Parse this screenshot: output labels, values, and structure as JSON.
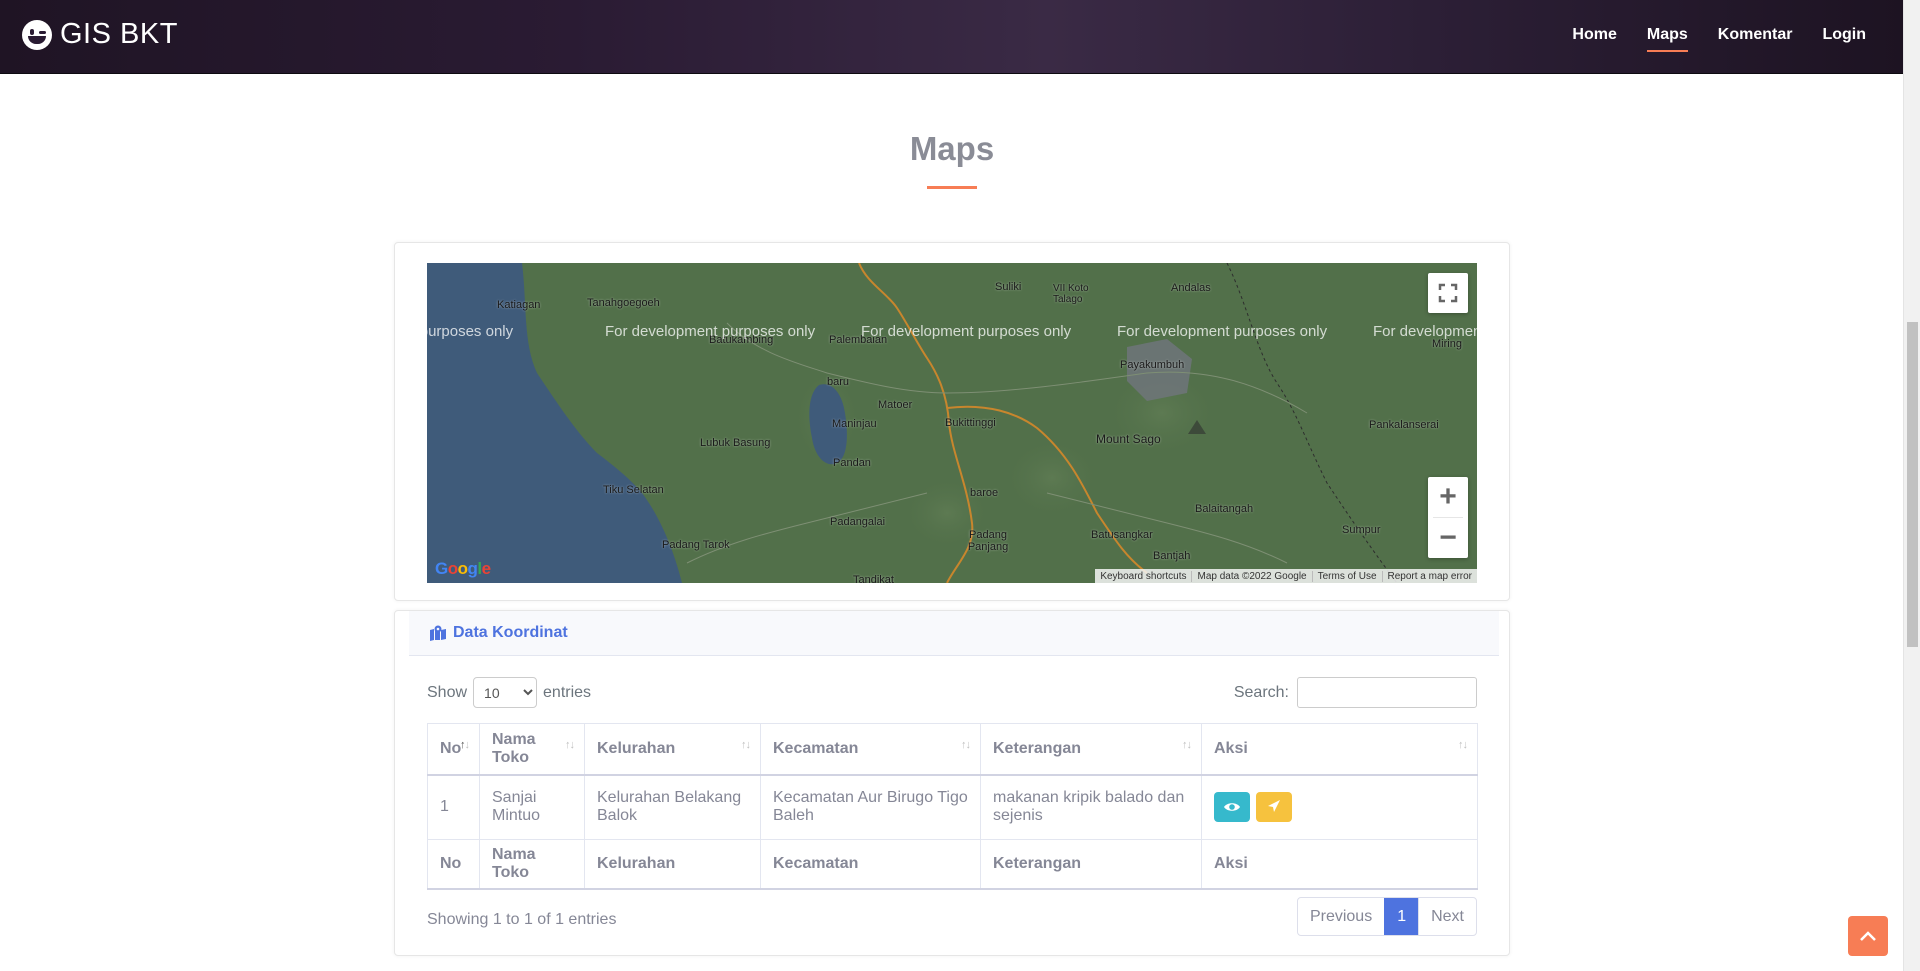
{
  "header": {
    "brand": "GIS BKT",
    "nav": [
      {
        "label": "Home"
      },
      {
        "label": "Maps"
      },
      {
        "label": "Komentar"
      },
      {
        "label": "Login"
      }
    ]
  },
  "section": {
    "title": "Maps"
  },
  "map": {
    "watermark": "For development purposes only",
    "labels": [
      "Katiagan",
      "Tanahgoegoeh",
      "Batukambing",
      "Palembaian",
      "Suliki",
      "VII Koto Talago",
      "Andalas",
      "Miring",
      "Payakumbuh",
      "baru",
      "Matoer",
      "Maninjau",
      "Bukittinggi",
      "Mount Sago",
      "Pankalanserai",
      "Lubuk Basung",
      "Pandan",
      "Tiku Selatan",
      "baroe",
      "Balaitangah",
      "Padangalai",
      "Padang Panjang",
      "Batusangkar",
      "Sumpur",
      "Padang Tarok",
      "Bantjah",
      "Tandikat"
    ],
    "attribution": [
      "Keyboard shortcuts",
      "Map data ©2022 Google",
      "Terms of Use",
      "Report a map error"
    ],
    "google": "Google",
    "zoom_in": "+",
    "zoom_out": "−"
  },
  "data_card": {
    "title": "Data Koordinat",
    "show_label": "Show",
    "entries_label": "entries",
    "page_size": "10",
    "search_label": "Search:",
    "columns": [
      "No",
      "Nama Toko",
      "Kelurahan",
      "Kecamatan",
      "Keterangan",
      "Aksi"
    ],
    "rows": [
      [
        "1",
        "Sanjai Mintuo",
        "Kelurahan Belakang Balok",
        "Kecamatan Aur Birugo Tigo Baleh",
        "makanan kripik balado dan sejenis"
      ]
    ],
    "info": "Showing 1 to 1 of 1 entries",
    "pager": {
      "prev": "Previous",
      "current": "1",
      "next": "Next"
    }
  },
  "colors": {
    "accent": "#f77d55",
    "primary": "#4e73df",
    "info": "#36b9cc",
    "warning": "#f6c23e"
  }
}
